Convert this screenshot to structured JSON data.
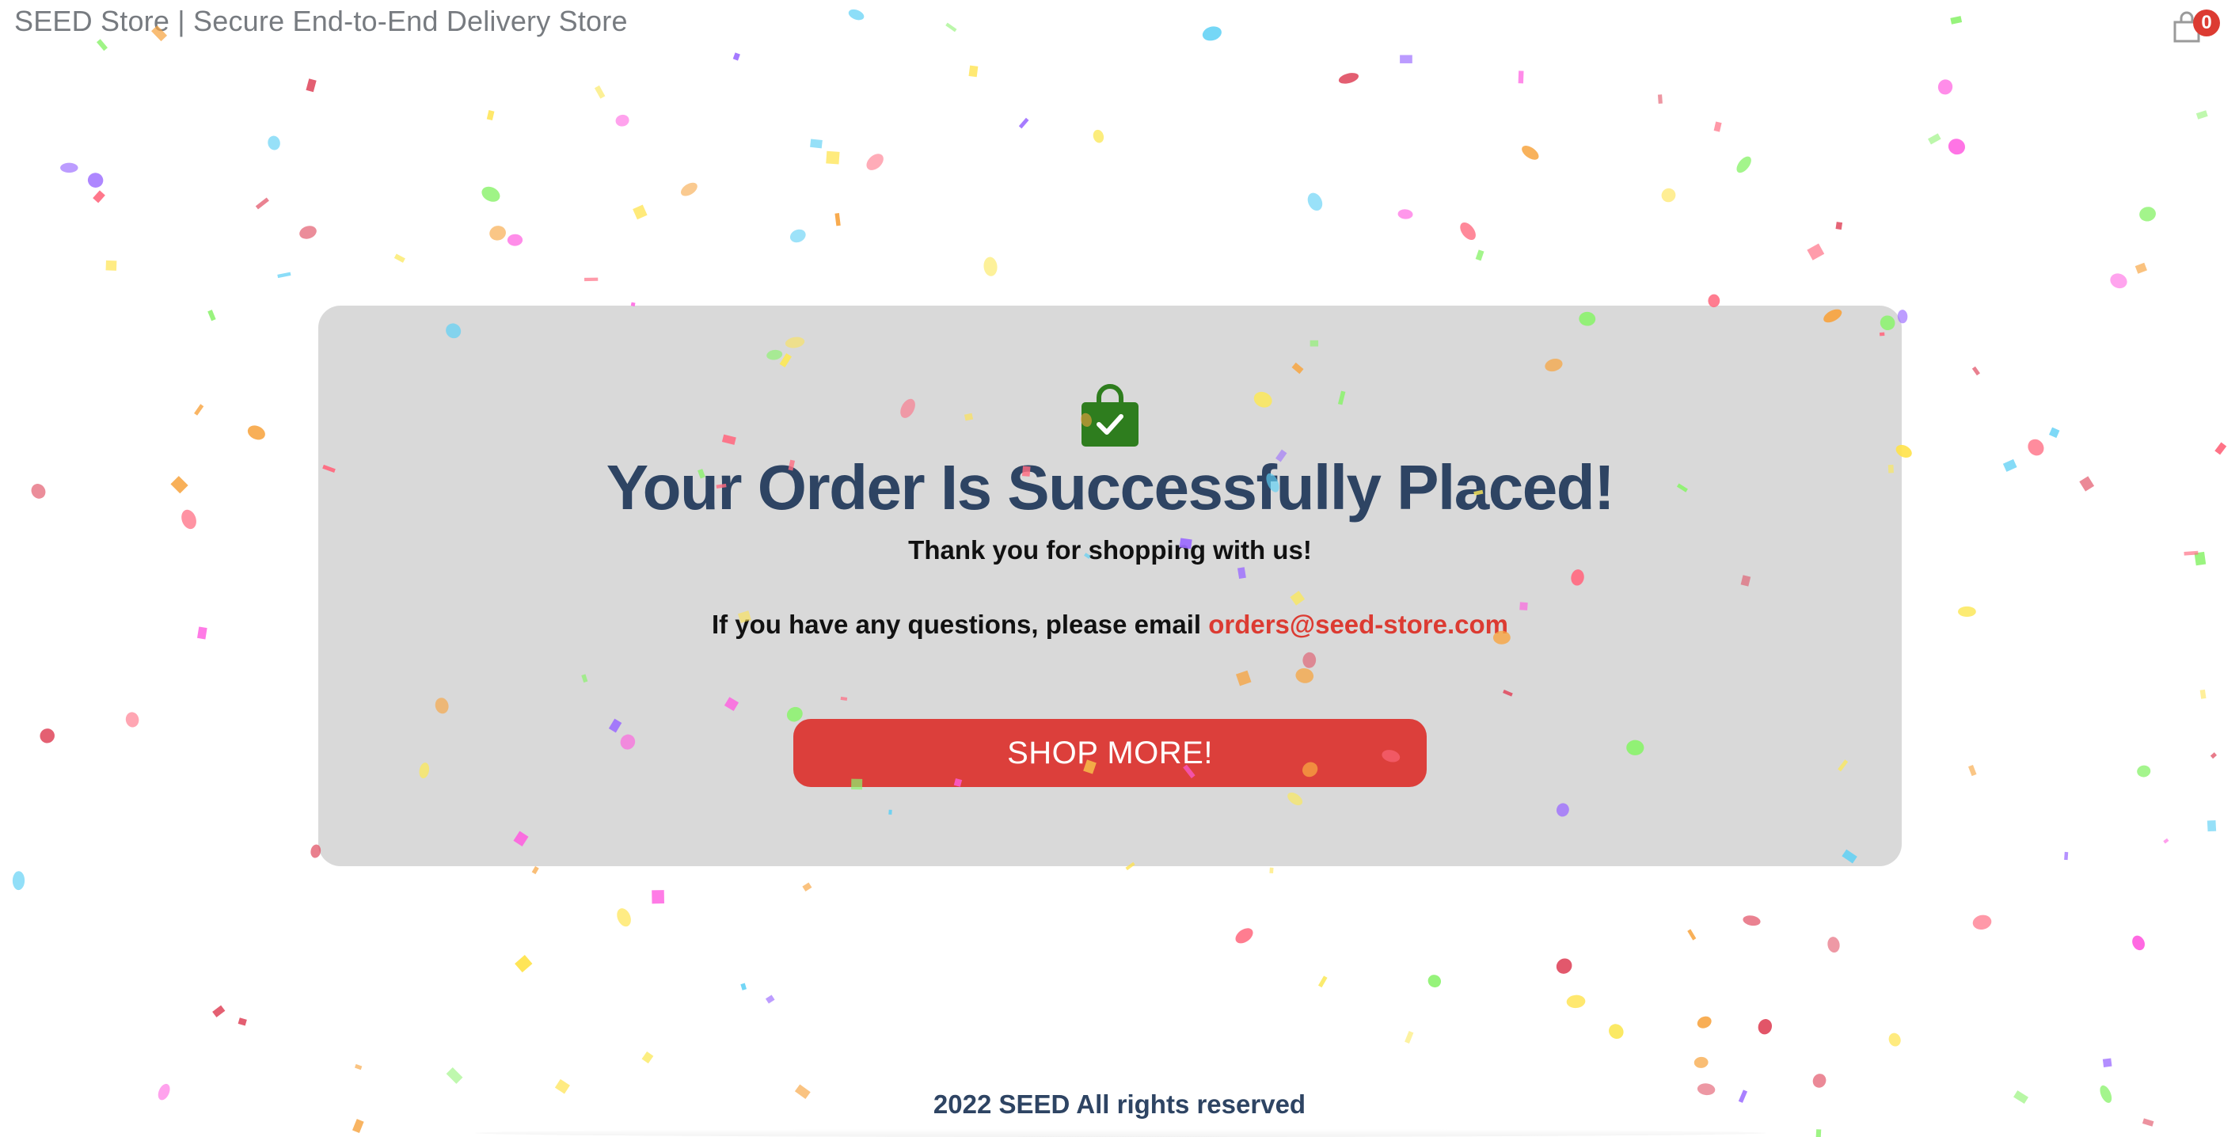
{
  "header": {
    "brand_title": "SEED Store | Secure End-to-End Delivery Store",
    "cart_icon": "shopping-bag-icon",
    "cart_count": "0"
  },
  "confirmation": {
    "icon": "shopping-bag-check-icon",
    "title": "Your Order Is Successfully Placed!",
    "subtitle": "Thank you for shopping with us!",
    "contact_prefix": "If you have any questions, please email",
    "contact_email": "orders@seed-store.com",
    "button_label": "SHOP MORE!"
  },
  "footer": {
    "text": "2022 SEED All rights reserved"
  },
  "colors": {
    "accent_red": "#dc3b32",
    "title_navy": "#2e4463",
    "success_green": "#2e7d1e",
    "card_gray": "#d9d9d9"
  }
}
